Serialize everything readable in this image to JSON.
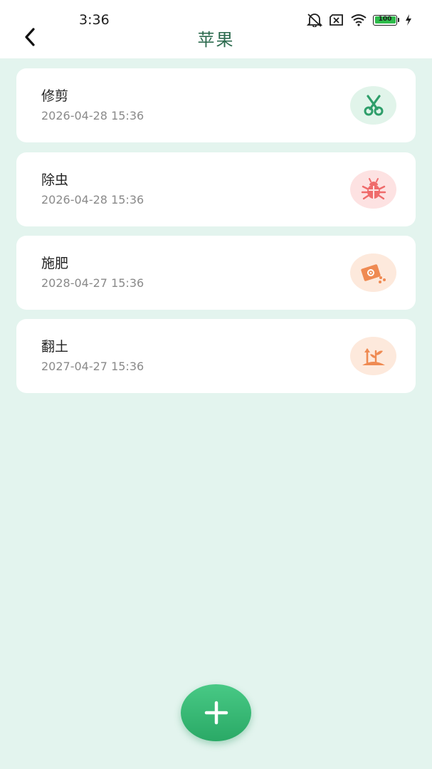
{
  "status_bar": {
    "time": "3:36",
    "battery_level": "100",
    "icons": [
      "mute-icon",
      "sim-off-icon",
      "wifi-icon",
      "battery-icon",
      "charging-icon"
    ]
  },
  "header": {
    "back_icon": "chevron-left-icon",
    "title": "苹果"
  },
  "records": [
    {
      "title": "修剪",
      "date": "2026-04-28 15:36",
      "icon": "scissors-icon",
      "icon_bg": "#e1f4ea",
      "icon_color": "#2e9e6a"
    },
    {
      "title": "除虫",
      "date": "2026-04-28 15:36",
      "icon": "bug-icon",
      "icon_bg": "#fde2e2",
      "icon_color": "#ef6b6b"
    },
    {
      "title": "施肥",
      "date": "2028-04-27 15:36",
      "icon": "fertilizer-icon",
      "icon_bg": "#fde9dc",
      "icon_color": "#ef8a52"
    },
    {
      "title": "翻土",
      "date": "2027-04-27 15:36",
      "icon": "shovel-soil-icon",
      "icon_bg": "#fde9dc",
      "icon_color": "#ef8a52"
    }
  ],
  "fab": {
    "icon": "plus-icon"
  }
}
